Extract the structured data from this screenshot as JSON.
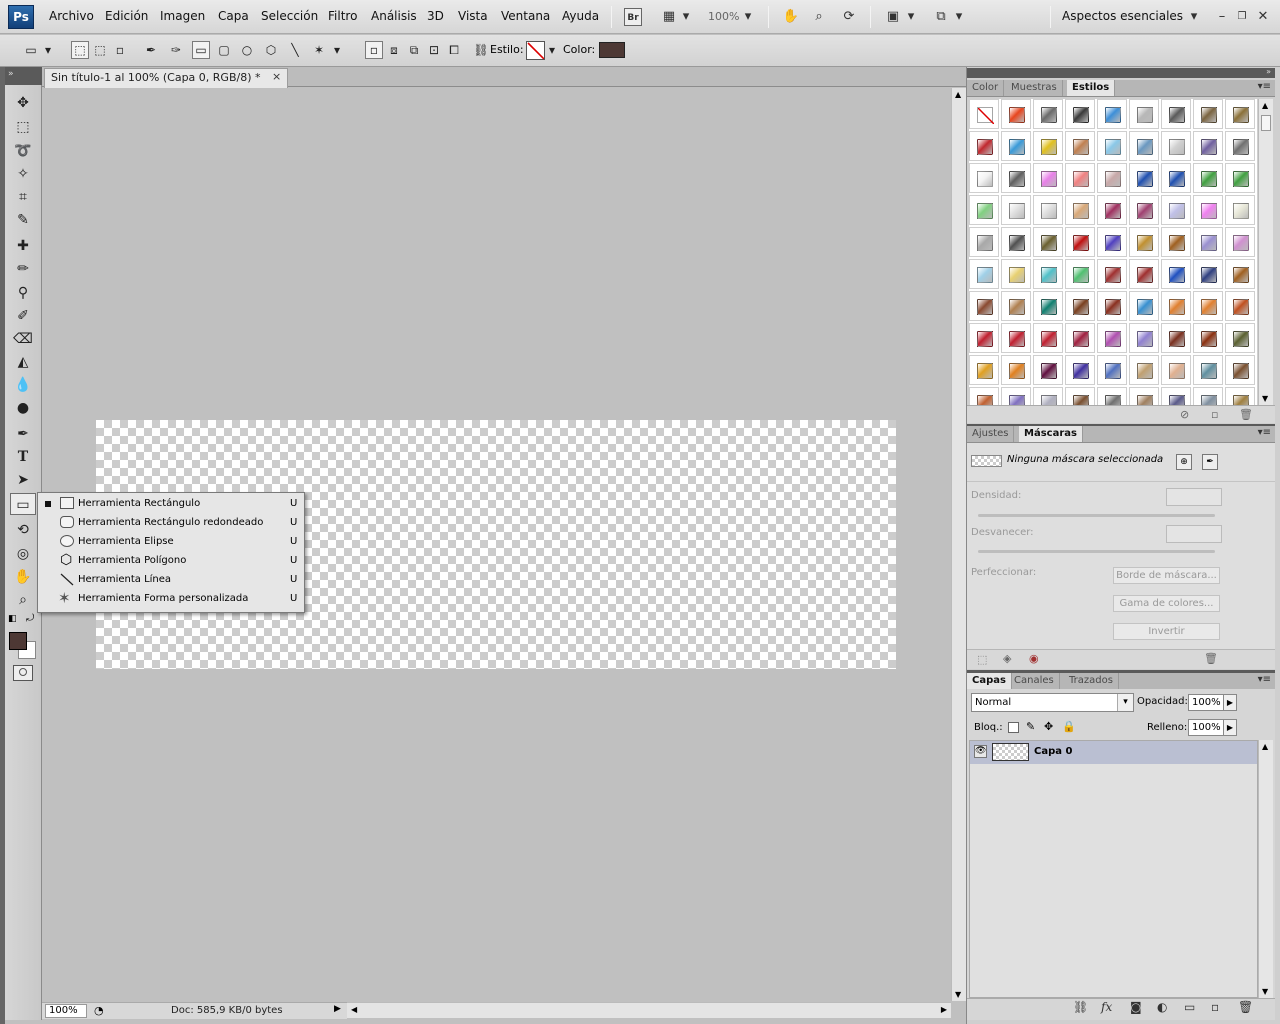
{
  "app": {
    "logo": "Ps"
  },
  "menu": [
    "Archivo",
    "Edición",
    "Imagen",
    "Capa",
    "Selección",
    "Filtro",
    "Análisis",
    "3D",
    "Vista",
    "Ventana",
    "Ayuda"
  ],
  "appbar": {
    "bridge": "Br",
    "zoom": "100%",
    "workspace": "Aspectos esenciales"
  },
  "options": {
    "estilo_label": "Estilo:",
    "color_label": "Color:",
    "color_value": "#4d3834"
  },
  "document": {
    "tab_title": "Sin título-1 al 100% (Capa 0, RGB/8) *",
    "close": "×"
  },
  "status": {
    "zoom": "100%",
    "doc": "Doc: 585,9 KB/0 bytes"
  },
  "flyout": [
    {
      "label": "Herramienta Rectángulo",
      "key": "U",
      "selected": true
    },
    {
      "label": "Herramienta Rectángulo redondeado",
      "key": "U",
      "selected": false
    },
    {
      "label": "Herramienta Elipse",
      "key": "U",
      "selected": false
    },
    {
      "label": "Herramienta Polígono",
      "key": "U",
      "selected": false
    },
    {
      "label": "Herramienta Línea",
      "key": "U",
      "selected": false
    },
    {
      "label": "Herramienta Forma personalizada",
      "key": "U",
      "selected": false
    }
  ],
  "styles_panel": {
    "tabs": [
      "Color",
      "Muestras",
      "Estilos"
    ],
    "active_tab": "Estilos",
    "swatch_colors": [
      "none",
      "#e8451e",
      "#6a6a6a",
      "#3a3a3a",
      "#3d8fd8",
      "#b8b8b8",
      "#5a5a5a",
      "#7a6440",
      "#8a7038",
      "#c0282f",
      "#3a9ad8",
      "#e0c020",
      "#c08050",
      "#8ac8e8",
      "#6a98c0",
      "#d0d0d0",
      "#7060a0",
      "#707070",
      "#f4f4f4",
      "#606060",
      "#e880e8",
      "#f08080",
      "#c8a8a8",
      "#2050b0",
      "#2050b0",
      "#40a040",
      "#40a040",
      "#80d080",
      "#e0e0e0",
      "#e0e0e0",
      "#d8a878",
      "#a03060",
      "#a04070",
      "#c0c0e8",
      "#f080f0",
      "#e8e8d8",
      "#a8a8a8",
      "#505050",
      "#6a6030",
      "#c01010",
      "#5040c0",
      "#c09030",
      "#a06020",
      "#9a90d0",
      "#d090d0",
      "#a0d0e8",
      "#e8d070",
      "#50c0c8",
      "#50c070",
      "#a03030",
      "#a03030",
      "#2050c0",
      "#304080",
      "#a06020",
      "#8a4a30",
      "#b08050",
      "#108070",
      "#7a4020",
      "#8a3020",
      "#3890d0",
      "#e08030",
      "#e08030",
      "#c05020",
      "#c02030",
      "#c02030",
      "#c02030",
      "#a02040",
      "#b050b0",
      "#9080d0",
      "#7a3020",
      "#8a3010",
      "#5a6030",
      "#e0a020",
      "#e08020",
      "#601040",
      "#4030a0",
      "#5070c0",
      "#c0a070",
      "#e0b090",
      "#6090a0",
      "#7a5030",
      "#c06030",
      "#8070c0",
      "#b0b0c0",
      "#7a5030",
      "#707070",
      "#a08060",
      "#5a5a8a",
      "#8090a0",
      "#a08040"
    ]
  },
  "masks_panel": {
    "tabs": [
      "Ajustes",
      "Máscaras"
    ],
    "active_tab": "Máscaras",
    "none_selected": "Ninguna máscara seleccionada",
    "density_label": "Densidad:",
    "feather_label": "Desvanecer:",
    "refine_label": "Perfeccionar:",
    "btn_edge": "Borde de máscara...",
    "btn_range": "Gama de colores...",
    "btn_invert": "Invertir"
  },
  "layers_panel": {
    "tabs": [
      "Capas",
      "Canales",
      "Trazados"
    ],
    "active_tab": "Capas",
    "blend_mode": "Normal",
    "opacity_label": "Opacidad:",
    "opacity": "100%",
    "lock_label": "Bloq.:",
    "fill_label": "Relleno:",
    "fill": "100%",
    "layers": [
      {
        "name": "Capa 0",
        "visible": true
      }
    ]
  },
  "colors": {
    "foreground": "#4d3834",
    "background": "#ffffff",
    "layer_highlight": "#babfd2"
  }
}
